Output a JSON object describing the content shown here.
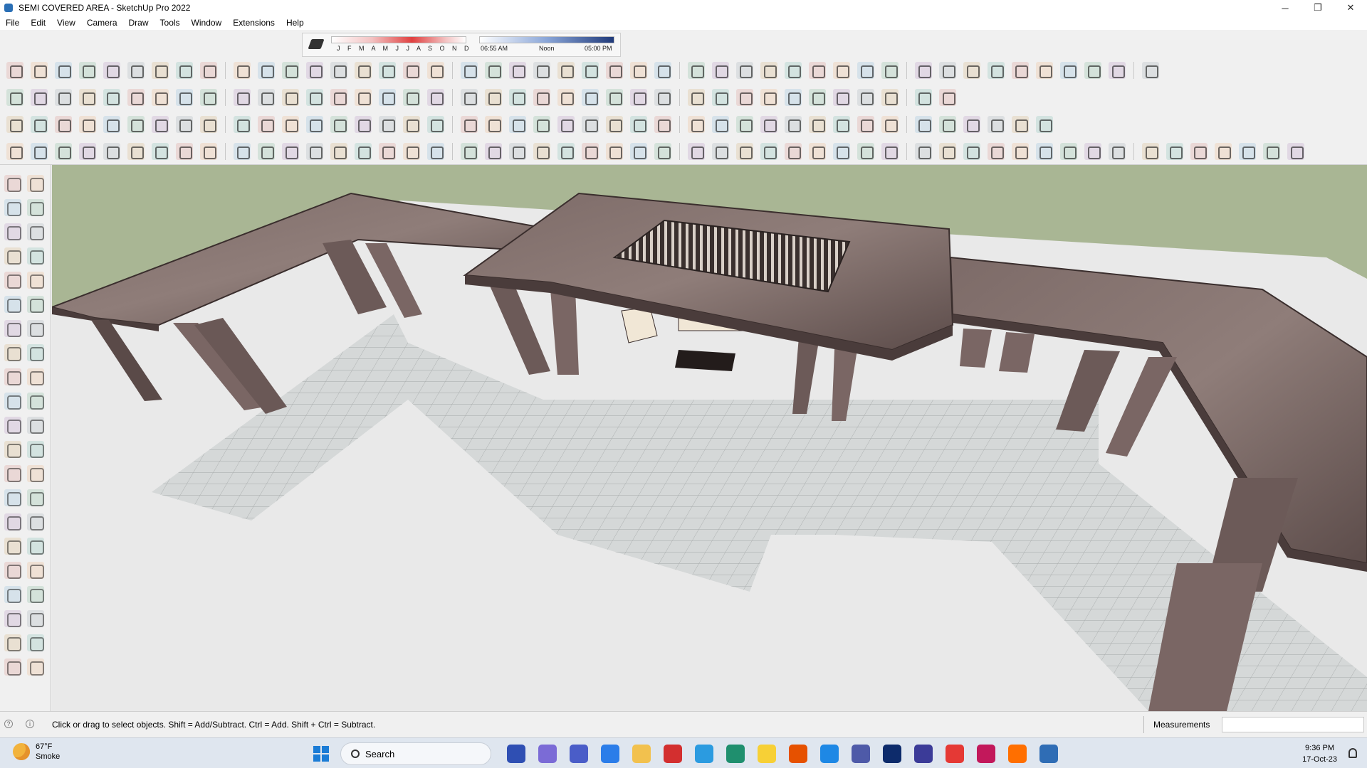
{
  "window": {
    "title": "SEMI COVERED AREA - SketchUp Pro 2022",
    "controls": [
      "─",
      "❐",
      "✕"
    ]
  },
  "menu": [
    "File",
    "Edit",
    "View",
    "Camera",
    "Draw",
    "Tools",
    "Window",
    "Extensions",
    "Help"
  ],
  "shadow_settings": {
    "months": "J F M A M J J A S O N D",
    "time_start": "06:55 AM",
    "time_mid": "Noon",
    "time_end": "05:00 PM"
  },
  "status": {
    "hint": "Click or drag to select objects. Shift = Add/Subtract. Ctrl = Add. Shift + Ctrl = Subtract.",
    "measurements_label": "Measurements",
    "measurements_value": ""
  },
  "taskbar": {
    "weather_temp": "67°F",
    "weather_desc": "Smoke",
    "search_placeholder": "Search",
    "time": "9:36 PM",
    "date": "17-Oct-23"
  },
  "colors": {
    "sky": "#a9b694",
    "ground": "#e9e9e9",
    "roof": "#6f5e5c",
    "roof_edge": "#4a3c3b",
    "floor_tile": "#d3d6d6",
    "accent_blue": "#1b7cd6"
  }
}
